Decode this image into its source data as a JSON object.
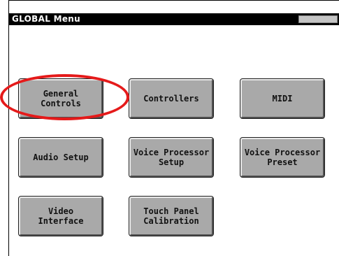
{
  "window": {
    "title": "GLOBAL Menu"
  },
  "buttons": [
    {
      "id": "general-controls",
      "label": "General\nControls"
    },
    {
      "id": "controllers",
      "label": "Controllers"
    },
    {
      "id": "midi",
      "label": "MIDI"
    },
    {
      "id": "audio-setup",
      "label": "Audio Setup"
    },
    {
      "id": "voice-processor-setup",
      "label": "Voice Processor\nSetup"
    },
    {
      "id": "voice-processor-preset",
      "label": "Voice Processor\nPreset"
    },
    {
      "id": "video-interface",
      "label": "Video\nInterface"
    },
    {
      "id": "touch-panel-calibration",
      "label": "Touch Panel\nCalibration"
    }
  ],
  "highlight": {
    "target": "general-controls",
    "color": "#e51a1a"
  }
}
